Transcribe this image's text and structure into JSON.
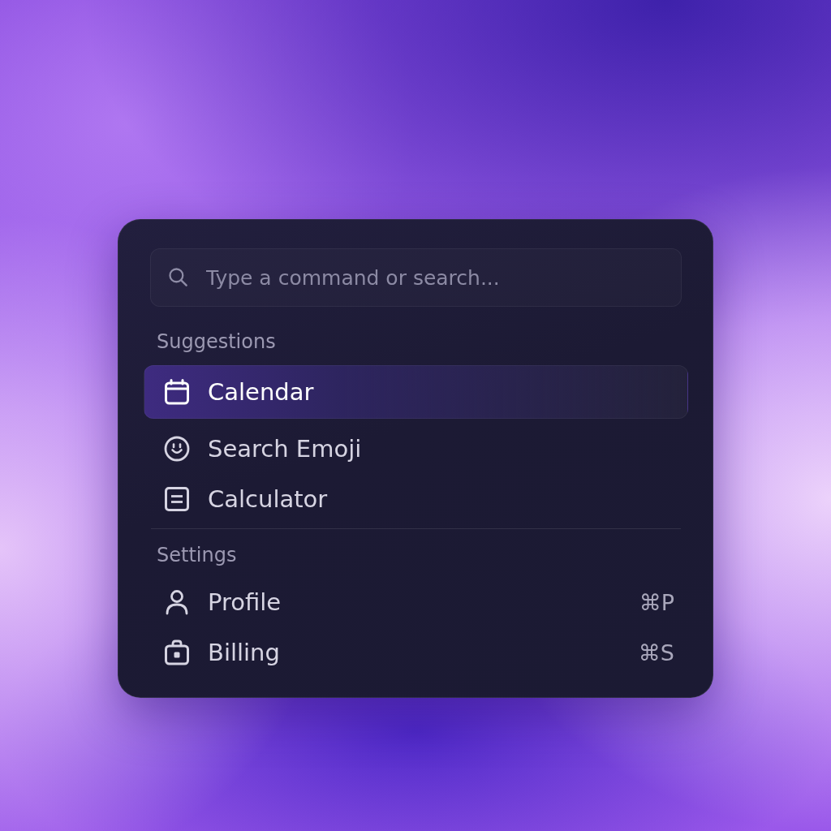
{
  "search": {
    "placeholder": "Type a command or search..."
  },
  "groups": [
    {
      "heading": "Suggestions",
      "items": [
        {
          "kind": "calendar",
          "label": "Calendar",
          "selected": true
        },
        {
          "kind": "emoji",
          "label": "Search Emoji",
          "selected": false
        },
        {
          "kind": "calculator",
          "label": "Calculator",
          "selected": false
        }
      ]
    },
    {
      "heading": "Settings",
      "items": [
        {
          "kind": "profile",
          "label": "Profile",
          "shortcut": "⌘P",
          "selected": false
        },
        {
          "kind": "billing",
          "label": "Billing",
          "shortcut": "⌘S",
          "selected": false
        }
      ]
    }
  ]
}
